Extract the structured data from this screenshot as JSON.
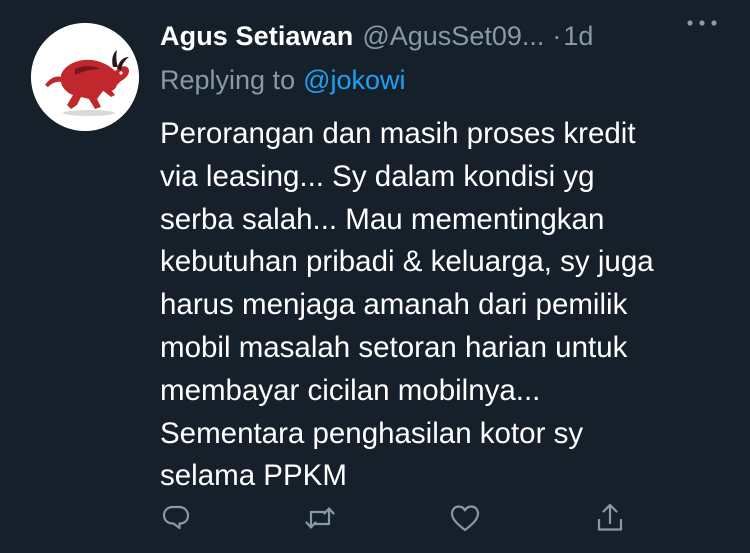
{
  "tweet": {
    "author_name": "Agus Setiawan",
    "author_handle": "@AgusSet09...",
    "separator": "·",
    "time": "1d",
    "replying_prefix": "Replying to",
    "replying_mention": "@jokowi",
    "body_lines": [
      "Perorangan dan masih proses kredit",
      "via leasing... Sy dalam kondisi yg",
      "serba salah... Mau mementingkan",
      "kebutuhan pribadi & keluarga, sy juga",
      "harus menjaga amanah dari pemilik",
      "mobil masalah setoran harian untuk",
      "membayar cicilan mobilnya...",
      "Sementara penghasilan kotor sy",
      "selama PPKM"
    ]
  },
  "icons": {
    "avatar": "red-bull-avatar",
    "more": "more-horizontal-icon",
    "reply": "reply-icon",
    "retweet": "retweet-icon",
    "like": "like-heart-icon",
    "share": "share-icon"
  },
  "colors": {
    "background": "#15202b",
    "primary_text": "#ffffff",
    "secondary_text": "#8899a6",
    "accent": "#1da1f2",
    "avatar_bull": "#c0282d"
  }
}
